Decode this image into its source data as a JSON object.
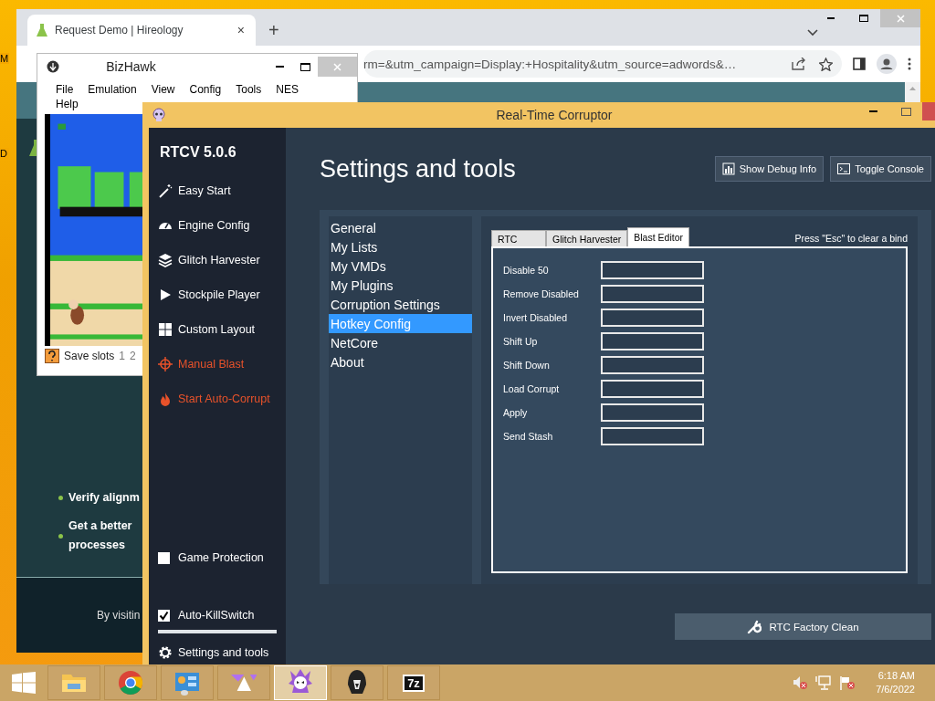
{
  "desktop": {
    "icon_labels": [
      "M",
      "D"
    ]
  },
  "browser": {
    "tab": {
      "title": "Request Demo | Hireology",
      "close": "×"
    },
    "new_tab": "+",
    "url": "rm=&utm_campaign=Display:+Hospitality&utm_source=adwords&…",
    "page": {
      "bullets": [
        {
          "lines": [
            "Verify alignm"
          ]
        },
        {
          "lines": [
            "Get a better",
            "processes"
          ]
        }
      ],
      "footer": "By visitin"
    }
  },
  "emulator": {
    "title": "BizHawk",
    "menu": [
      "File",
      "Emulation",
      "View",
      "Config",
      "Tools",
      "NES",
      "Help"
    ],
    "status": {
      "label": "Save slots",
      "slots": [
        "1",
        "2"
      ]
    }
  },
  "rtc": {
    "title": "Real-Time Corruptor",
    "sidebar": {
      "version": "RTCV 5.0.6",
      "items": [
        {
          "label": "Easy Start",
          "kind": "nav"
        },
        {
          "label": "Engine Config",
          "kind": "nav"
        },
        {
          "label": "Glitch Harvester",
          "kind": "nav"
        },
        {
          "label": "Stockpile Player",
          "kind": "nav"
        },
        {
          "label": "Custom Layout",
          "kind": "nav"
        },
        {
          "label": "Manual Blast",
          "kind": "action"
        },
        {
          "label": "Start Auto-Corrupt",
          "kind": "action"
        }
      ],
      "checkboxes": [
        {
          "label": "Game Protection",
          "checked": false
        },
        {
          "label": "Auto-KillSwitch",
          "checked": true
        }
      ],
      "footer_item": "Settings and tools"
    },
    "heading": "Settings and tools",
    "header_buttons": [
      "Show Debug Info",
      "Toggle Console"
    ],
    "settings_menu": [
      {
        "label": "General",
        "selected": false
      },
      {
        "label": "My Lists",
        "selected": false
      },
      {
        "label": "My VMDs",
        "selected": false
      },
      {
        "label": "My Plugins",
        "selected": false
      },
      {
        "label": "Corruption Settings",
        "selected": false
      },
      {
        "label": "Hotkey Config",
        "selected": true
      },
      {
        "label": "NetCore",
        "selected": false
      },
      {
        "label": "About",
        "selected": false
      }
    ],
    "hotkeys": {
      "tabs": [
        {
          "label": "RTC",
          "selected": false
        },
        {
          "label": "Glitch Harvester",
          "selected": false
        },
        {
          "label": "Blast Editor",
          "selected": true
        }
      ],
      "hint": "Press \"Esc\" to clear a bind",
      "rows": [
        "Disable 50",
        "Remove Disabled",
        "Invert Disabled",
        "Shift Up",
        "Shift Down",
        "Load Corrupt",
        "Apply",
        "Send Stash"
      ]
    },
    "factory_clean": "RTC Factory Clean"
  },
  "taskbar": {
    "apps": [
      {
        "kind": "folder",
        "selected": false
      },
      {
        "kind": "browser",
        "selected": false
      },
      {
        "kind": "control-panel",
        "selected": false
      },
      {
        "kind": "triangle",
        "selected": false
      },
      {
        "kind": "corruptor",
        "selected": true
      },
      {
        "kind": "hood",
        "selected": false
      },
      {
        "kind": "archive",
        "selected": false,
        "label": "7z"
      }
    ],
    "clock": {
      "time": "6:18 AM",
      "date": "7/6/2022"
    }
  }
}
